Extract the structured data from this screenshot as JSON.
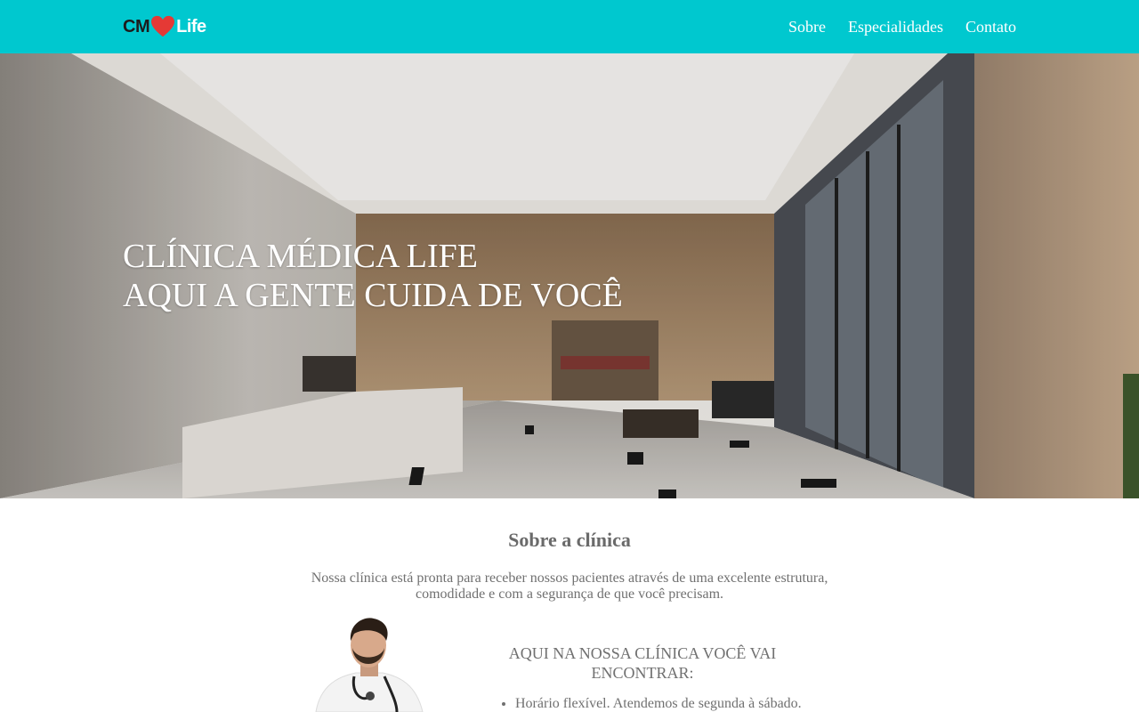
{
  "header": {
    "logo_prefix": "CM",
    "logo_suffix": "Life",
    "nav": [
      {
        "label": "Sobre"
      },
      {
        "label": "Especialidades"
      },
      {
        "label": "Contato"
      }
    ]
  },
  "hero": {
    "line1": "CLÍNICA MÉDICA LIFE",
    "line2": "AQUI A GENTE CUIDA DE VOCÊ"
  },
  "about": {
    "title": "Sobre a clínica",
    "description_line1": "Nossa clínica está pronta para receber nossos pacientes através de uma excelente estrutura,",
    "description_line2": "comodidade e com a segurança de que você precisam.",
    "encontrar_line1": "AQUI NA NOSSA CLÍNICA VOCÊ VAI",
    "encontrar_line2": "ENCONTRAR:",
    "features": [
      "Horário flexível. Atendemos de segunda à sábado."
    ]
  },
  "colors": {
    "header_bg": "#00c8cf",
    "heart": "#e53935",
    "text_gray": "#707070"
  }
}
